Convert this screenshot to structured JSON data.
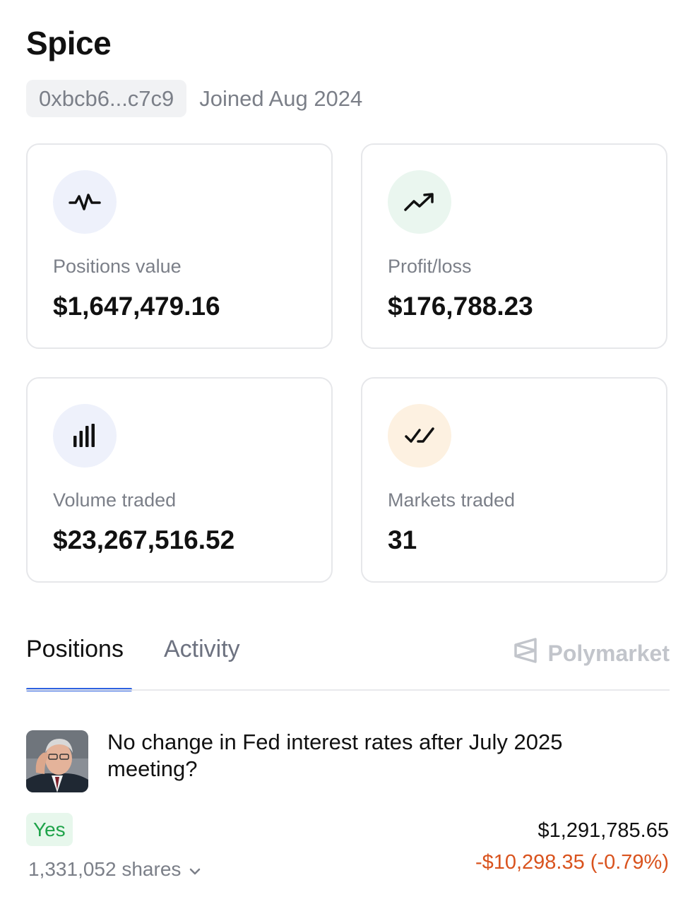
{
  "profile": {
    "name": "Spice",
    "address": "0xbcb6...c7c9",
    "joined": "Joined Aug 2024"
  },
  "stats": [
    {
      "label": "Positions value",
      "value": "$1,647,479.16",
      "icon": "activity-pulse-icon",
      "icon_bg": "#eef1fb"
    },
    {
      "label": "Profit/loss",
      "value": "$176,788.23",
      "icon": "trending-up-icon",
      "icon_bg": "#eaf6ef"
    },
    {
      "label": "Volume traded",
      "value": "$23,267,516.52",
      "icon": "bar-chart-icon",
      "icon_bg": "#eef1fb"
    },
    {
      "label": "Markets traded",
      "value": "31",
      "icon": "double-check-icon",
      "icon_bg": "#fdf1e1"
    }
  ],
  "tabs": {
    "positions": "Positions",
    "activity": "Activity",
    "active": "positions",
    "accent": "#2d61e0"
  },
  "brand": {
    "name": "Polymarket"
  },
  "position": {
    "market_title": "No change in Fed interest rates after July 2025 meeting?",
    "outcome": "Yes",
    "shares": "1,331,052 shares",
    "value": "$1,291,785.65",
    "pnl": "-$10,298.35 (-0.79%)",
    "pnl_color": "#d9531e",
    "outcome_color": "#1fa34a"
  }
}
